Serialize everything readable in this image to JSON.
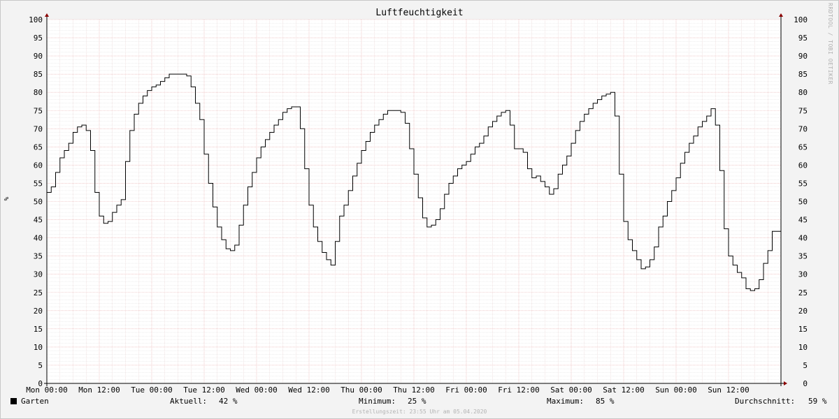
{
  "chart_data": {
    "type": "line",
    "title": "Luftfeuchtigkeit",
    "unit": "%",
    "watermark": "RRDTOOL / TOBI OETIKER",
    "ylim": [
      0,
      100
    ],
    "y_ticks": [
      0,
      5,
      10,
      15,
      20,
      25,
      30,
      35,
      40,
      45,
      50,
      55,
      60,
      65,
      70,
      75,
      80,
      85,
      90,
      95,
      100
    ],
    "x_tick_labels": [
      "Mon 00:00",
      "Mon 12:00",
      "Tue 00:00",
      "Tue 12:00",
      "Wed 00:00",
      "Wed 12:00",
      "Thu 00:00",
      "Thu 12:00",
      "Fri 00:00",
      "Fri 12:00",
      "Sat 00:00",
      "Sat 12:00",
      "Sun 00:00",
      "Sun 12:00"
    ],
    "x_range_hours": [
      0,
      168
    ],
    "grid": true,
    "series": [
      {
        "name": "Garten",
        "color": "#000000",
        "points": [
          [
            0,
            52.5
          ],
          [
            1,
            54
          ],
          [
            2,
            58
          ],
          [
            3,
            62
          ],
          [
            4,
            64
          ],
          [
            5,
            66
          ],
          [
            6,
            69
          ],
          [
            7,
            70.5
          ],
          [
            8,
            71
          ],
          [
            9,
            69.5
          ],
          [
            10,
            64
          ],
          [
            11,
            52.5
          ],
          [
            12,
            46
          ],
          [
            13,
            44
          ],
          [
            14,
            44.5
          ],
          [
            15,
            47
          ],
          [
            16,
            49
          ],
          [
            17,
            50.5
          ],
          [
            18,
            61
          ],
          [
            19,
            69.5
          ],
          [
            20,
            74
          ],
          [
            21,
            77
          ],
          [
            22,
            79
          ],
          [
            23,
            80.5
          ],
          [
            24,
            81.5
          ],
          [
            25,
            82
          ],
          [
            26,
            83
          ],
          [
            27,
            84
          ],
          [
            28,
            85
          ],
          [
            29,
            85
          ],
          [
            30,
            85
          ],
          [
            31,
            85
          ],
          [
            32,
            84.5
          ],
          [
            33,
            81.5
          ],
          [
            34,
            77
          ],
          [
            35,
            72.5
          ],
          [
            36,
            63
          ],
          [
            37,
            55
          ],
          [
            38,
            48.5
          ],
          [
            39,
            43
          ],
          [
            40,
            39.5
          ],
          [
            41,
            37
          ],
          [
            42,
            36.5
          ],
          [
            43,
            38
          ],
          [
            44,
            43.5
          ],
          [
            45,
            49
          ],
          [
            46,
            54
          ],
          [
            47,
            58
          ],
          [
            48,
            62
          ],
          [
            49,
            65
          ],
          [
            50,
            67
          ],
          [
            51,
            69
          ],
          [
            52,
            71
          ],
          [
            53,
            72.5
          ],
          [
            54,
            74.5
          ],
          [
            55,
            75.5
          ],
          [
            56,
            76
          ],
          [
            57,
            76
          ],
          [
            58,
            70
          ],
          [
            59,
            59
          ],
          [
            60,
            49
          ],
          [
            61,
            43
          ],
          [
            62,
            39
          ],
          [
            63,
            36
          ],
          [
            64,
            34
          ],
          [
            65,
            32.5
          ],
          [
            66,
            39
          ],
          [
            67,
            46
          ],
          [
            68,
            49
          ],
          [
            69,
            53
          ],
          [
            70,
            57
          ],
          [
            71,
            60.5
          ],
          [
            72,
            64
          ],
          [
            73,
            66.5
          ],
          [
            74,
            69
          ],
          [
            75,
            71
          ],
          [
            76,
            72.5
          ],
          [
            77,
            74
          ],
          [
            78,
            75
          ],
          [
            79,
            75
          ],
          [
            80,
            75
          ],
          [
            81,
            74.5
          ],
          [
            82,
            71.5
          ],
          [
            83,
            64.5
          ],
          [
            84,
            57.5
          ],
          [
            85,
            51
          ],
          [
            86,
            45.5
          ],
          [
            87,
            43
          ],
          [
            88,
            43.5
          ],
          [
            89,
            45
          ],
          [
            90,
            48
          ],
          [
            91,
            52
          ],
          [
            92,
            55
          ],
          [
            93,
            57
          ],
          [
            94,
            59
          ],
          [
            95,
            60
          ],
          [
            96,
            61
          ],
          [
            97,
            63
          ],
          [
            98,
            65
          ],
          [
            99,
            66
          ],
          [
            100,
            68
          ],
          [
            101,
            70.5
          ],
          [
            102,
            72
          ],
          [
            103,
            73.5
          ],
          [
            104,
            74.5
          ],
          [
            105,
            75
          ],
          [
            106,
            71
          ],
          [
            107,
            64.5
          ],
          [
            108,
            64.5
          ],
          [
            109,
            63.5
          ],
          [
            110,
            59
          ],
          [
            111,
            56.5
          ],
          [
            112,
            57
          ],
          [
            113,
            55.5
          ],
          [
            114,
            54
          ],
          [
            115,
            52
          ],
          [
            116,
            53.5
          ],
          [
            117,
            57.5
          ],
          [
            118,
            60
          ],
          [
            119,
            62.5
          ],
          [
            120,
            66
          ],
          [
            121,
            69.5
          ],
          [
            122,
            72
          ],
          [
            123,
            74
          ],
          [
            124,
            75.5
          ],
          [
            125,
            77
          ],
          [
            126,
            78
          ],
          [
            127,
            79
          ],
          [
            128,
            79.5
          ],
          [
            129,
            80
          ],
          [
            130,
            73.5
          ],
          [
            131,
            57.5
          ],
          [
            132,
            44.5
          ],
          [
            133,
            39.5
          ],
          [
            134,
            36.5
          ],
          [
            135,
            34
          ],
          [
            136,
            31.5
          ],
          [
            137,
            32
          ],
          [
            138,
            34
          ],
          [
            139,
            37.5
          ],
          [
            140,
            43
          ],
          [
            141,
            46
          ],
          [
            142,
            50
          ],
          [
            143,
            53
          ],
          [
            144,
            56.5
          ],
          [
            145,
            60.5
          ],
          [
            146,
            63.5
          ],
          [
            147,
            66
          ],
          [
            148,
            68
          ],
          [
            149,
            70.5
          ],
          [
            150,
            72
          ],
          [
            151,
            73.5
          ],
          [
            152,
            75.5
          ],
          [
            153,
            71
          ],
          [
            154,
            58.5
          ],
          [
            155,
            42.5
          ],
          [
            156,
            35
          ],
          [
            157,
            32.5
          ],
          [
            158,
            30.5
          ],
          [
            159,
            29
          ],
          [
            160,
            26
          ],
          [
            161,
            25.5
          ],
          [
            162,
            26
          ],
          [
            163,
            28.5
          ],
          [
            164,
            33
          ],
          [
            165,
            36.5
          ],
          [
            166,
            41.8
          ],
          [
            167,
            41.8
          ]
        ]
      }
    ]
  },
  "legend": {
    "series_name": "Garten",
    "current_label": "Aktuell:",
    "current_value": "42 %",
    "min_label": "Minimum:",
    "min_value": "25 %",
    "max_label": "Maximum:",
    "max_value": "85 %",
    "avg_label": "Durchschnitt:",
    "avg_value": "59 %"
  },
  "footer": "Erstellungszeit: 23:55 Uhr am 05.04.2020"
}
